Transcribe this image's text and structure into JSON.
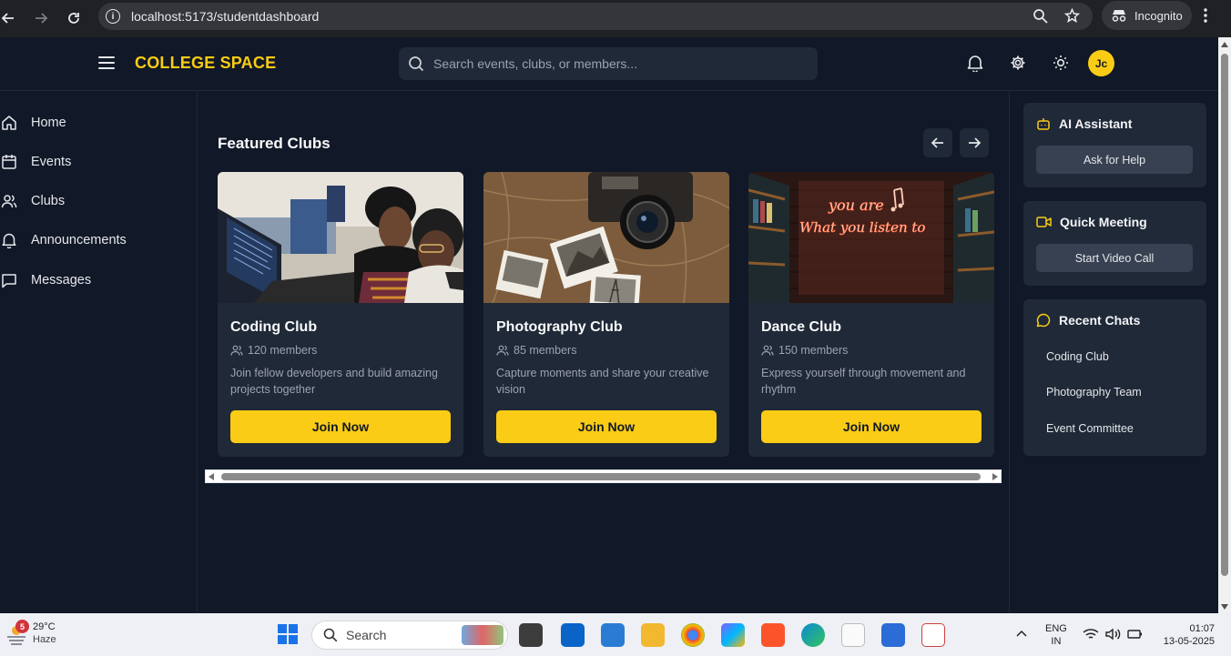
{
  "browser": {
    "url_host": "localhost",
    "url_path": ":5173/studentdashboard",
    "incognito_label": "Incognito"
  },
  "header": {
    "brand": "COLLEGE SPACE",
    "search_placeholder": "Search events, clubs, or members...",
    "avatar_initials": "Jc",
    "accent": "#facc15"
  },
  "sidebar": {
    "items": [
      {
        "label": "Home",
        "icon": "home-icon"
      },
      {
        "label": "Events",
        "icon": "calendar-icon"
      },
      {
        "label": "Clubs",
        "icon": "users-icon"
      },
      {
        "label": "Announcements",
        "icon": "bell-icon"
      },
      {
        "label": "Messages",
        "icon": "message-square-icon"
      }
    ]
  },
  "main": {
    "section_title": "Featured Clubs",
    "clubs": [
      {
        "name": "Coding Club",
        "members": "120 members",
        "description": "Join fellow developers and build amazing projects together",
        "button": "Join Now"
      },
      {
        "name": "Photography Club",
        "members": "85 members",
        "description": "Capture moments and share your creative vision",
        "button": "Join Now"
      },
      {
        "name": "Dance Club",
        "members": "150 members",
        "description": "Express yourself through movement and rhythm",
        "button": "Join Now"
      }
    ],
    "neon_text_line1": "you are",
    "neon_text_line2": "What you listen to"
  },
  "right_panel": {
    "ai_assistant": {
      "title": "AI Assistant",
      "button": "Ask for Help"
    },
    "quick_meeting": {
      "title": "Quick Meeting",
      "button": "Start Video Call"
    },
    "recent_chats": {
      "title": "Recent Chats",
      "items": [
        "Coding Club",
        "Photography Team",
        "Event Committee"
      ]
    }
  },
  "taskbar": {
    "weather_temp": "29°C",
    "weather_desc": "Haze",
    "weather_badge": "5",
    "search_label": "Search",
    "lang_line1": "ENG",
    "lang_line2": "IN",
    "time": "01:07",
    "date": "13-05-2025"
  }
}
